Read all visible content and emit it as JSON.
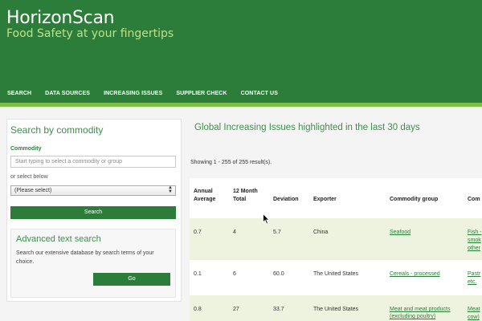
{
  "header": {
    "brand": "HorizonScan",
    "tagline": "Food Safety at your fingertips",
    "nav": [
      "SEARCH",
      "DATA SOURCES",
      "INCREASING ISSUES",
      "SUPPLIER CHECK",
      "CONTACT US"
    ]
  },
  "sidebar": {
    "title": "Search by commodity",
    "commodity_label": "Commodity",
    "commodity_placeholder": "Start typing to select a commodity or group",
    "or_select": "or select below",
    "select_value": "(Please select)",
    "search_button": "Search",
    "advanced": {
      "title": "Advanced text search",
      "description": "Search our extensive database by search terms of your choice.",
      "go_button": "Go"
    }
  },
  "main": {
    "title": "Global Increasing Issues highlighted in the last 30 days",
    "result_count": "Showing 1 - 255 of 255 result(s).",
    "columns": [
      "Annual Average",
      "12 Month Total",
      "Deviation",
      "Exporter",
      "Commodity group",
      "Com"
    ],
    "rows": [
      {
        "annual": "0.7",
        "total": "4",
        "deviation": "5.7",
        "exporter": "China",
        "group": "Seafood",
        "commodity": [
          "Fish -",
          "smok",
          "other"
        ]
      },
      {
        "annual": "0.1",
        "total": "6",
        "deviation": "60.0",
        "exporter": "The United States",
        "group": "Cereals - processed",
        "commodity": [
          "Pastr",
          "etc."
        ]
      },
      {
        "annual": "0.8",
        "total": "27",
        "deviation": "33.7",
        "exporter": "The United States",
        "group": "Meat and meat products (excluding poultry)",
        "commodity": [
          "Meat",
          "cow)"
        ]
      }
    ]
  }
}
